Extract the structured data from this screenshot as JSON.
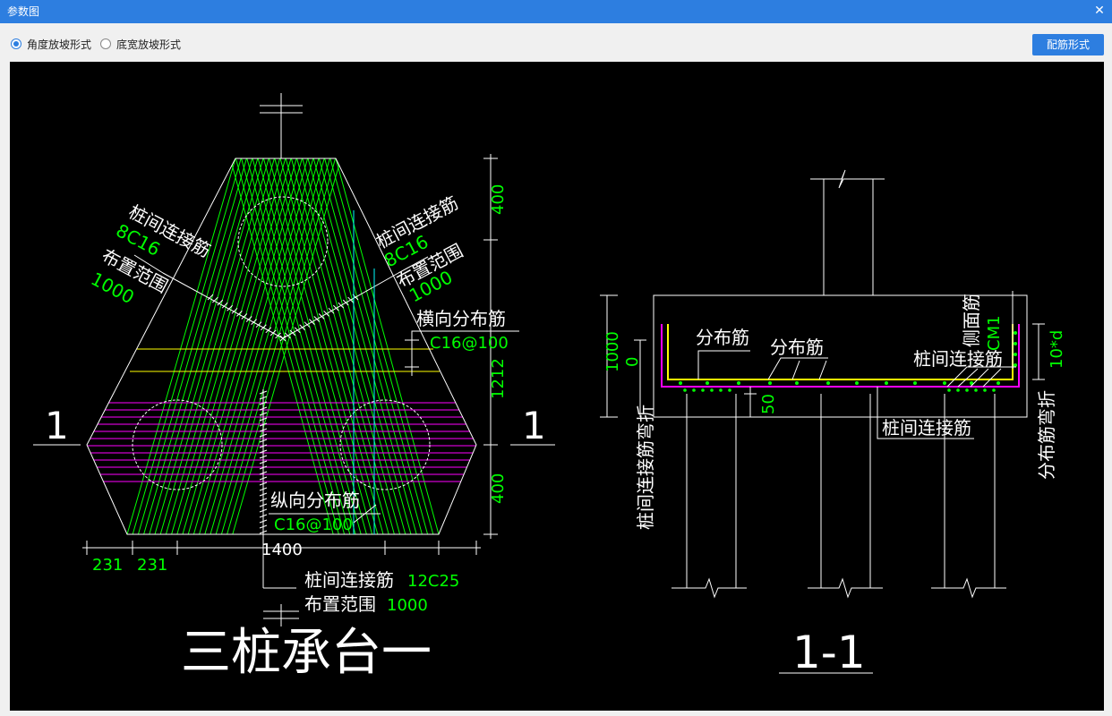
{
  "window": {
    "title": "参数图",
    "close_icon": "close-icon"
  },
  "toolbar": {
    "options": [
      {
        "label": "角度放坡形式",
        "selected": true
      },
      {
        "label": "底宽放坡形式",
        "selected": false
      }
    ],
    "button_label": "配筋形式"
  },
  "colors": {
    "accent": "#2d7ee0",
    "background": "#000000",
    "white": "#ffffff",
    "green": "#00ff00",
    "magenta": "#ff00ff",
    "yellow": "#ffff00",
    "cyan": "#00ffff"
  },
  "drawing": {
    "plan": {
      "title": "三桩承台一",
      "section_mark": "1",
      "dims": {
        "top_right_1": "400",
        "top_right_2": "1212",
        "bottom_right": "400",
        "bottom_left_1": "231",
        "bottom_left_2": "231",
        "bottom_total": "1400"
      },
      "labels": {
        "left_rebar_name": "桩间连接筋",
        "left_rebar_spec": "8C16",
        "left_range_name": "布置范围",
        "left_range_value": "1000",
        "right_rebar_name": "桩间连接筋",
        "right_rebar_spec": "8C16",
        "right_range_name": "布置范围",
        "right_range_value": "1000",
        "transverse_name": "横向分布筋",
        "transverse_spec": "C16@100",
        "longitudinal_name": "纵向分布筋",
        "longitudinal_spec": "C16@100",
        "bottom_rebar_name": "桩间连接筋",
        "bottom_rebar_spec": "12C25",
        "bottom_range_name": "布置范围",
        "bottom_range_value": "1000"
      }
    },
    "section": {
      "title": "1-1",
      "dims": {
        "height_1": "1000",
        "height_2": "0",
        "cover": "50",
        "anchor": "10*d"
      },
      "labels": {
        "dist_1": "分布筋",
        "dist_2": "分布筋",
        "side_rebar": "侧面筋",
        "side_rebar_spec": "CM1",
        "pile_link_1": "桩间连接筋",
        "pile_link_2": "桩间连接筋",
        "pile_link_bend": "桩间连接筋弯折",
        "dist_bend": "分布筋弯折"
      }
    }
  }
}
